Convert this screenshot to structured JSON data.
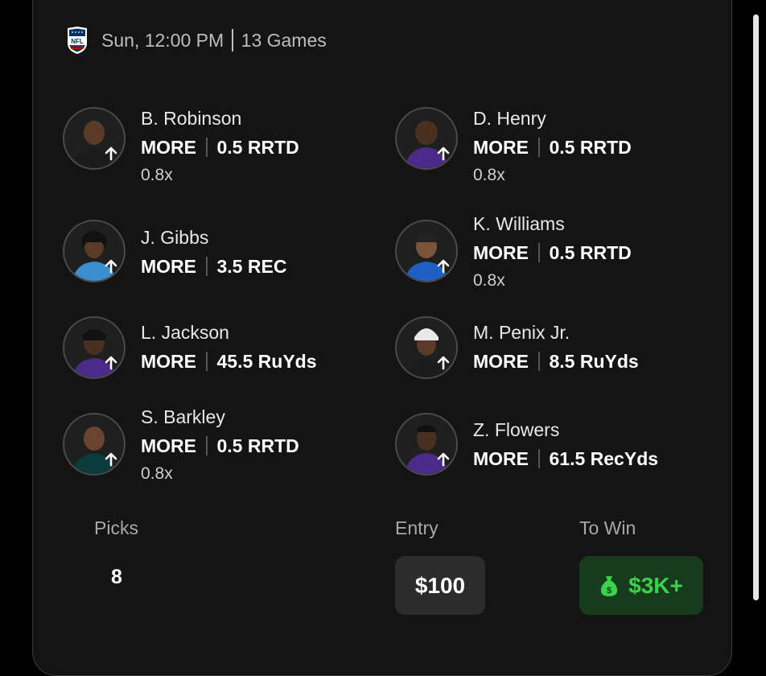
{
  "header": {
    "league_icon": "nfl-shield-icon",
    "time": "Sun, 12:00 PM",
    "games": "13 Games"
  },
  "picks": [
    {
      "name": "B. Robinson",
      "direction": "MORE",
      "line": "0.5 RRTD",
      "multiplier": "0.8x",
      "jersey_color": "#1c1c1c"
    },
    {
      "name": "D. Henry",
      "direction": "MORE",
      "line": "0.5 RRTD",
      "multiplier": "0.8x",
      "jersey_color": "#4b2a8a"
    },
    {
      "name": "J. Gibbs",
      "direction": "MORE",
      "line": "3.5 REC",
      "multiplier": "",
      "jersey_color": "#3b8fd0"
    },
    {
      "name": "K. Williams",
      "direction": "MORE",
      "line": "0.5 RRTD",
      "multiplier": "0.8x",
      "jersey_color": "#1f5fc4"
    },
    {
      "name": "L. Jackson",
      "direction": "MORE",
      "line": "45.5 RuYds",
      "multiplier": "",
      "jersey_color": "#4b2a8a"
    },
    {
      "name": "M. Penix Jr.",
      "direction": "MORE",
      "line": "8.5 RuYds",
      "multiplier": "",
      "jersey_color": "#1c1c1c"
    },
    {
      "name": "S. Barkley",
      "direction": "MORE",
      "line": "0.5 RRTD",
      "multiplier": "0.8x",
      "jersey_color": "#0b3b3b"
    },
    {
      "name": "Z. Flowers",
      "direction": "MORE",
      "line": "61.5 RecYds",
      "multiplier": "",
      "jersey_color": "#4b2a8a"
    }
  ],
  "summary": {
    "picks_label": "Picks",
    "picks_value": "8",
    "entry_label": "Entry",
    "entry_value": "$100",
    "to_win_label": "To Win",
    "to_win_value": "$3K+",
    "to_win_icon": "money-bag-icon"
  },
  "colors": {
    "card_bg": "#141414",
    "win_green": "#3ad14b",
    "win_bg": "#173b1c"
  }
}
